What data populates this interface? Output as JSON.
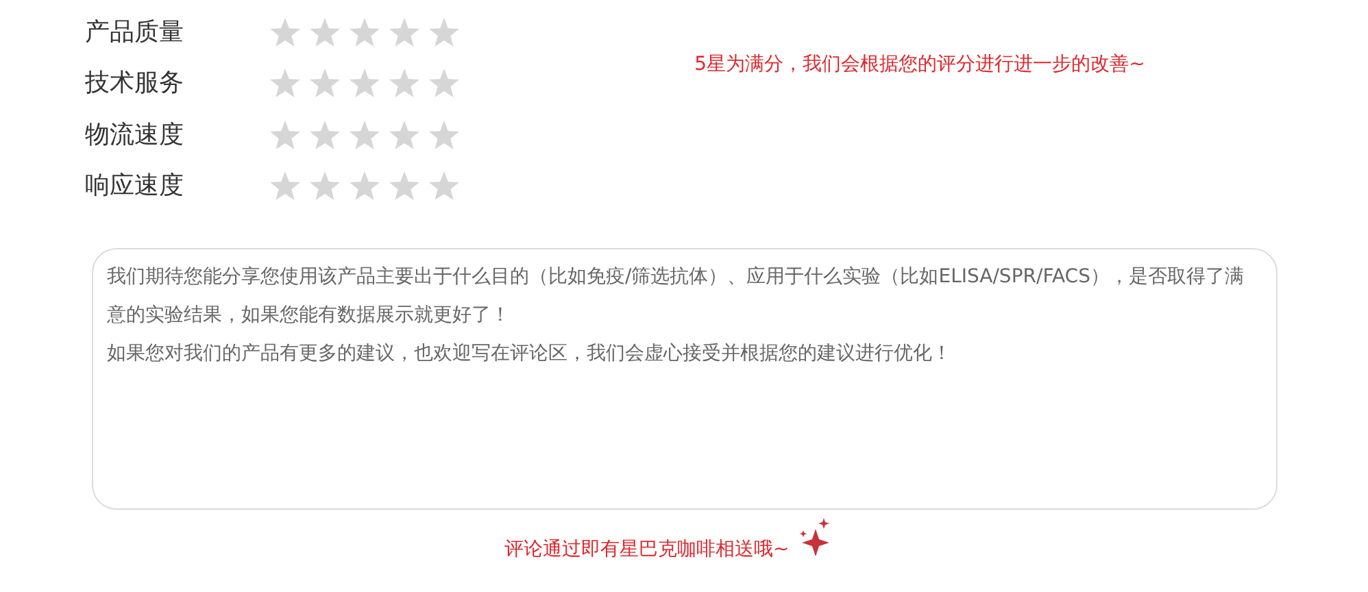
{
  "ratings": [
    {
      "label": "产品质量",
      "stars": 0
    },
    {
      "label": "技术服务",
      "stars": 0
    },
    {
      "label": "物流速度",
      "stars": 0
    },
    {
      "label": "响应速度",
      "stars": 0
    }
  ],
  "rating_note": "5星为满分，我们会根据您的评分进行进一步的改善~",
  "comment": {
    "placeholder_lines": [
      "我们期待您能分享您使用该产品主要出于什么目的（比如免疫/筛选抗体）、应用于什么实验（比如ELISA/SPR/FACS），是否取得了满意的实验结果，如果您能有数据展示就更好了！",
      "如果您对我们的产品有更多的建议，也欢迎写在评论区，我们会虚心接受并根据您的建议进行优化！"
    ]
  },
  "reward_note": "评论通过即有星巴克咖啡相送哦~"
}
